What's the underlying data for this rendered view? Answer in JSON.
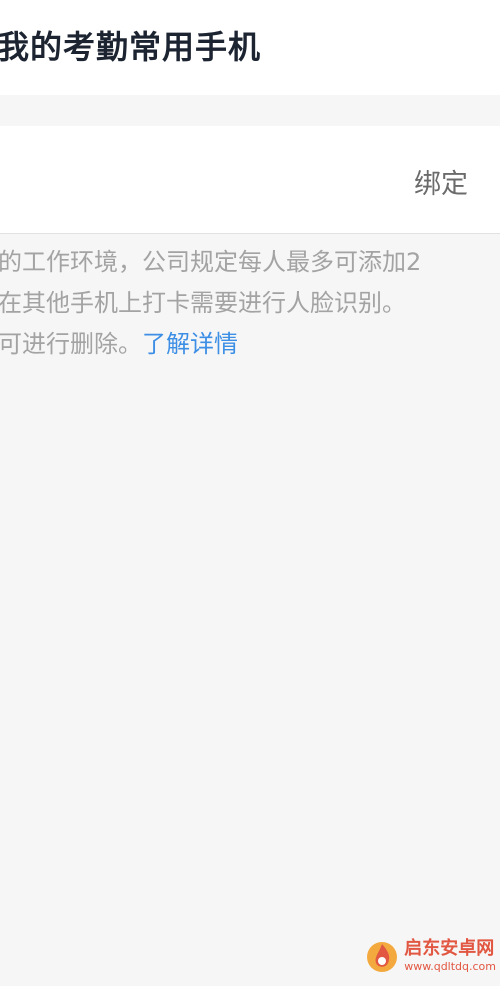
{
  "header": {
    "title": "我的考勤常用手机"
  },
  "device": {
    "bind_label": "绑定"
  },
  "note": {
    "line1": "的工作环境，公司规定每人最多可添加2",
    "line2": "在其他手机上打卡需要进行人脸识别。",
    "line3": "可进行删除。",
    "link_label": "了解详情"
  },
  "watermark": {
    "name": "启东安卓网",
    "url": "www.qdltdq.com"
  },
  "colors": {
    "link": "#3d8fe6",
    "title": "#1c2331",
    "watermark": "#e0462f"
  },
  "icons": {
    "watermark_logo": "flame-logo-icon"
  }
}
